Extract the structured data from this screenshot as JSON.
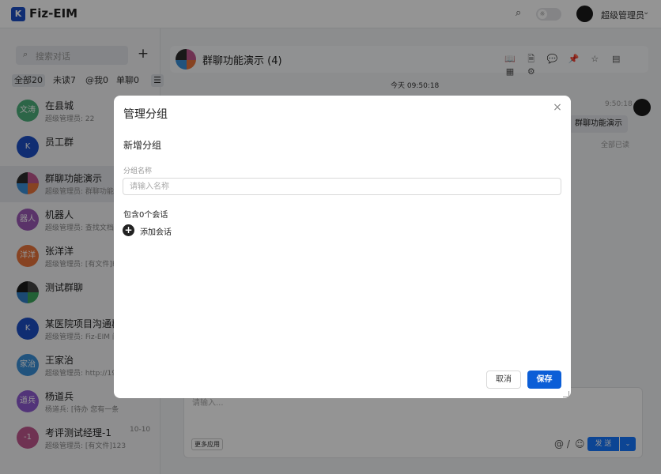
{
  "app": {
    "logo_text": "K",
    "title": "Fiz-EIM"
  },
  "topbar": {
    "user_name": "超级管理员",
    "caret": "⌄",
    "search_icon": "⌕",
    "theme_icon": "☼"
  },
  "sidebar": {
    "search_placeholder": "搜索对话",
    "add_label": "+",
    "filters": [
      "全部20",
      "未读7",
      "@我0",
      "单聊0"
    ],
    "menu_icon": "☰",
    "conversations": [
      {
        "name": "在县城",
        "preview": "超级管理员: 22",
        "avatar_text": "文涛",
        "avatar_color": "#4caf7a",
        "time": ""
      },
      {
        "name": "员工群",
        "preview": "",
        "avatar_text": "K",
        "avatar_color": "#1d4fc4",
        "time": ""
      },
      {
        "name": "群聊功能演示",
        "preview": "超级管理员: 群聊功能演示",
        "avatar_text": "",
        "avatar_color": "",
        "time": ""
      },
      {
        "name": "机器人",
        "preview": "超级管理员: 查找文档",
        "avatar_text": "器人",
        "avatar_color": "#9b59b6",
        "time": ""
      },
      {
        "name": "张洋洋",
        "preview": "超级管理员: [有文件]File",
        "avatar_text": "洋洋",
        "avatar_color": "#e8743b",
        "time": ""
      },
      {
        "name": "测试群聊",
        "preview": "",
        "avatar_text": "",
        "avatar_color": "",
        "time": ""
      },
      {
        "name": "某医院项目沟通群",
        "preview": "超级管理员: Fiz-EIM 问",
        "avatar_text": "K",
        "avatar_color": "#1d4fc4",
        "time": ""
      },
      {
        "name": "王家治",
        "preview": "超级管理员: http://192",
        "avatar_text": "家治",
        "avatar_color": "#3a8fd8",
        "time": ""
      },
      {
        "name": "杨道兵",
        "preview": "杨道兵: [待办 您有一条",
        "avatar_text": "道兵",
        "avatar_color": "#8e5bd0",
        "time": ""
      },
      {
        "name": "考评测试经理-1",
        "preview": "超级管理员: [有文件]123",
        "avatar_text": "-1",
        "avatar_color": "#c0568d",
        "time": "10-10"
      }
    ]
  },
  "chat": {
    "title": "群聊功能演示 (4)",
    "header_icons": [
      "📖",
      "🗎",
      "💬",
      "📌",
      "☆",
      "▤",
      "▦",
      "⚙"
    ],
    "day_label": "今天 09:50:18",
    "message_time": "9:50:18",
    "message_text": "群聊功能演示",
    "read_status": "全部已读",
    "composer_placeholder": "请输入...",
    "more_apps": "更多应用",
    "at_icon": "@ /",
    "emoji_icon": "☺",
    "send_label": "发 送",
    "send_drop": "⌄"
  },
  "modal": {
    "title": "管理分组",
    "close_icon": "×",
    "section_title": "新增分组",
    "field_label": "分组名称",
    "field_placeholder": "请输入名称",
    "field_value": "",
    "contains_text": "包含0个会话",
    "add_conversation_label": "添加会话",
    "cancel_label": "取消",
    "save_label": "保存"
  },
  "colors": {
    "primary": "#0b5ed7",
    "send": "#1677ff",
    "overlay": "rgba(0,0,0,0.42)"
  }
}
